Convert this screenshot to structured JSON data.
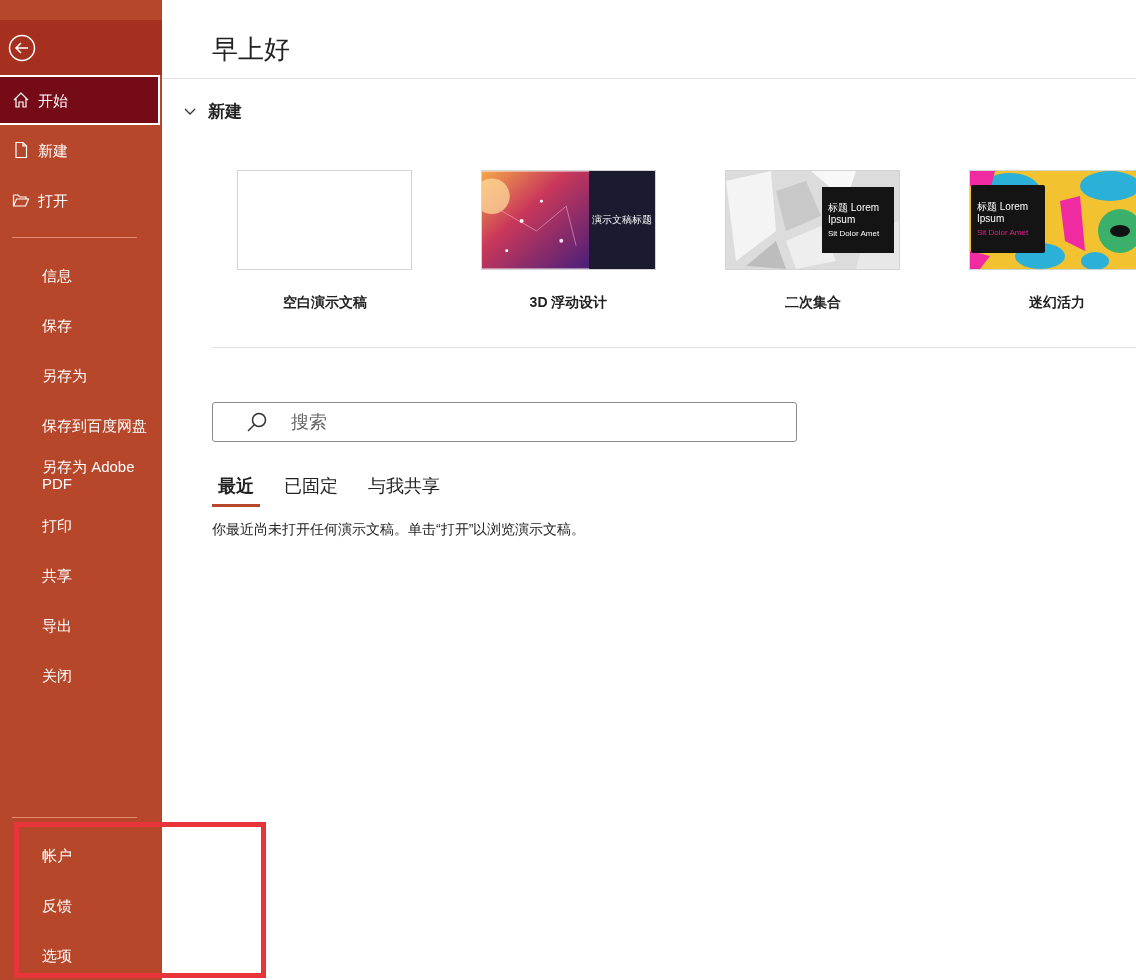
{
  "sidebar": {
    "groups": [
      [
        {
          "label": "开始",
          "selected": true
        },
        {
          "label": "新建",
          "selected": false
        },
        {
          "label": "打开",
          "selected": false
        }
      ],
      [
        {
          "label": "信息",
          "selected": false
        },
        {
          "label": "保存",
          "selected": false
        },
        {
          "label": "另存为",
          "selected": false
        },
        {
          "label": "保存到百度网盘",
          "selected": false
        },
        {
          "label": "另存为 Adobe PDF",
          "selected": false
        },
        {
          "label": "打印",
          "selected": false
        },
        {
          "label": "共享",
          "selected": false
        },
        {
          "label": "导出",
          "selected": false
        },
        {
          "label": "关闭",
          "selected": false
        }
      ],
      [
        {
          "label": "帐户",
          "selected": false
        },
        {
          "label": "反馈",
          "selected": false
        },
        {
          "label": "选项",
          "selected": false
        }
      ]
    ]
  },
  "greeting": "早上好",
  "new_section": {
    "title": "新建",
    "expanded": true,
    "templates": [
      {
        "kind": "blank",
        "name": "空白演示文稿"
      },
      {
        "kind": "starfield",
        "name": "3D 浮动设计",
        "slide_title": "演示文稿标题"
      },
      {
        "kind": "cubes",
        "name": "二次集合",
        "slide_title": "标题 Lorem Ipsum",
        "slide_subtitle": "Sit Dolor Amet"
      },
      {
        "kind": "pattern",
        "name": "迷幻活力",
        "slide_title": "标题 Lorem Ipsum",
        "slide_subtitle": "Sit Dolor Amet"
      }
    ]
  },
  "search": {
    "placeholder": "搜索"
  },
  "tabs": [
    {
      "label": "最近",
      "selected": true
    },
    {
      "label": "已固定",
      "selected": false
    },
    {
      "label": "与我共享",
      "selected": false
    }
  ],
  "empty_message": "你最近尚未打开任何演示文稿。单击“打开”以浏览演示文稿。"
}
